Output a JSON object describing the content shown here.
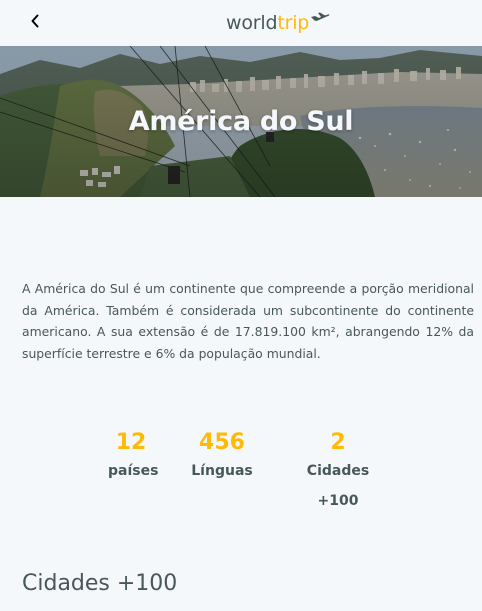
{
  "header": {
    "back_icon": "chevron-left-icon",
    "logo_world": "world",
    "logo_trip": "trip",
    "logo_icon": "airplane-icon"
  },
  "banner": {
    "title": "América do Sul"
  },
  "description": "A América do Sul é um continente que compreende a porção meridional da América. Também é considerada um subcontinente do continente americano. A sua extensão é de 17.819.100 km², abrangendo 12% da superfície terrestre e 6% da população mundial.",
  "stats": [
    {
      "value": "12",
      "label": "países"
    },
    {
      "value": "456",
      "label": "Línguas"
    },
    {
      "value": "2",
      "label": "Cidades +100"
    }
  ],
  "section": {
    "title": "Cidades +100"
  },
  "colors": {
    "accent": "#FFBA08",
    "text": "#47585B",
    "background": "#F5F8FA"
  }
}
